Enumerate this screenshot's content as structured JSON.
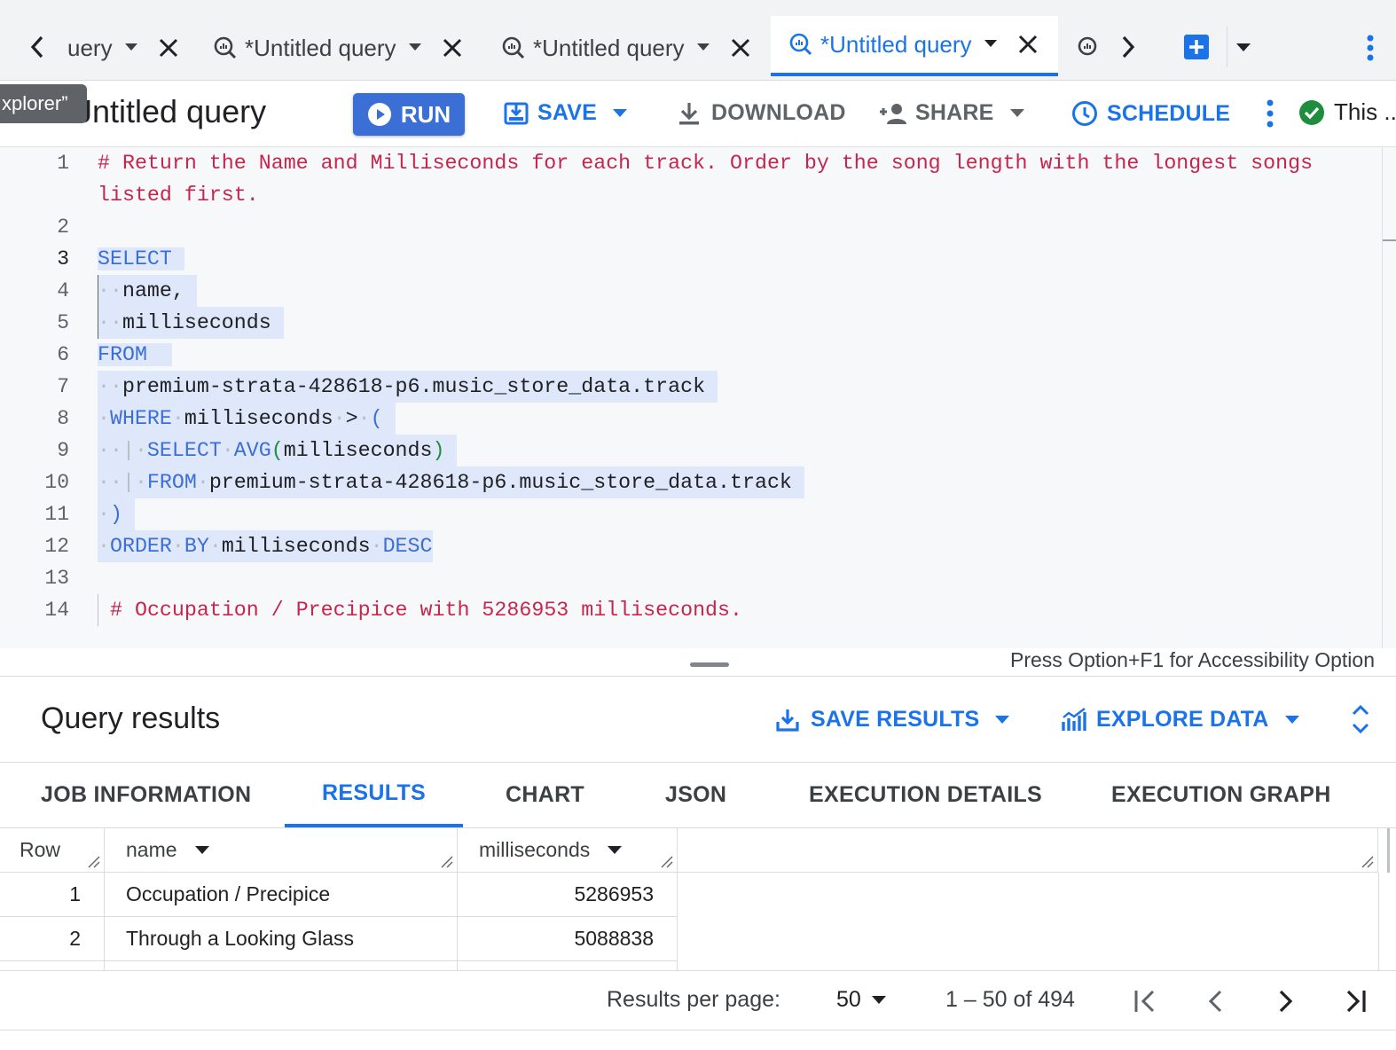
{
  "tabs": [
    {
      "label": "uery",
      "active": false
    },
    {
      "label": "*Untitled query",
      "active": false
    },
    {
      "label": "*Untitled query",
      "active": false
    },
    {
      "label": "*Untitled query",
      "active": true
    }
  ],
  "tooltip": "xplorer”",
  "query_title": "Jntitled query",
  "toolbar": {
    "run": "RUN",
    "save": "SAVE",
    "download": "DOWNLOAD",
    "share": "SHARE",
    "schedule": "SCHEDULE",
    "status": "This ..."
  },
  "editor": {
    "line_numbers": [
      "1",
      "2",
      "3",
      "4",
      "5",
      "6",
      "7",
      "8",
      "9",
      "10",
      "11",
      "12",
      "13",
      "14"
    ],
    "comment_line1a": "# Return the Name and Milliseconds for each track. Order by the song length with the longest songs",
    "comment_line1b": "listed first.",
    "select": "SELECT",
    "name_col": "name,",
    "ms_col": "milliseconds",
    "from": "FROM",
    "table": "premium-strata-428618-p6.music_store_data.track",
    "where": "WHERE",
    "where_col": "milliseconds",
    "gt": ">",
    "paren_open": "(",
    "sub_select": "SELECT",
    "avg": "AVG",
    "avg_arg_open": "(",
    "avg_arg": "milliseconds",
    "avg_arg_close": ")",
    "sub_from": "FROM",
    "sub_table": "premium-strata-428618-p6.music_store_data.track",
    "paren_close": ")",
    "order": "ORDER",
    "by": "BY",
    "order_col": "milliseconds",
    "desc": "DESC",
    "comment_line14": "# Occupation / Precipice with 5286953 milliseconds.",
    "accessibility_hint": "Press Option+F1 for Accessibility Option"
  },
  "results": {
    "title": "Query results",
    "save_results": "SAVE RESULTS",
    "explore_data": "EXPLORE DATA",
    "tabs": [
      "JOB INFORMATION",
      "RESULTS",
      "CHART",
      "JSON",
      "EXECUTION DETAILS",
      "EXECUTION GRAPH"
    ],
    "columns": [
      "Row",
      "name",
      "milliseconds"
    ],
    "rows": [
      {
        "row": "1",
        "name": "Occupation / Precipice",
        "milliseconds": "5286953"
      },
      {
        "row": "2",
        "name": "Through a Looking Glass",
        "milliseconds": "5088838"
      }
    ]
  },
  "pager": {
    "per_page_label": "Results per page:",
    "per_page_value": "50",
    "range": "1 – 50 of 494"
  },
  "colors": {
    "accent": "#1a73e8",
    "comment": "#c5264d",
    "keyword": "#3b6fd6",
    "highlight": "#dfe7fa"
  }
}
